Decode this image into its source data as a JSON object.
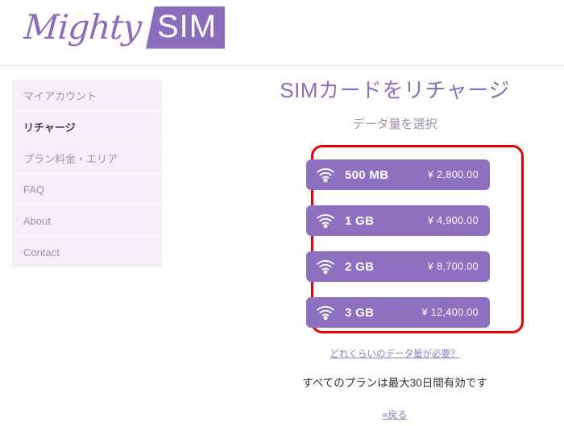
{
  "brand": {
    "name_script": "Mighty",
    "name_badge": "SIM",
    "accent_color": "#8a6ebd"
  },
  "sidebar": {
    "items": [
      {
        "label": "マイアカウント",
        "active": false
      },
      {
        "label": "リチャージ",
        "active": true
      },
      {
        "label": "プラン料金・エリア",
        "active": false
      },
      {
        "label": "FAQ",
        "active": false
      },
      {
        "label": "About",
        "active": false
      },
      {
        "label": "Contact",
        "active": false
      }
    ]
  },
  "main": {
    "title": "SIMカードをリチャージ",
    "subtitle": "データ量を選択",
    "highlight_color": "#ee0000",
    "plans": [
      {
        "size": "500 MB",
        "price": "¥ 2,800.00",
        "icon": "wifi-icon"
      },
      {
        "size": "1 GB",
        "price": "¥ 4,900.00",
        "icon": "wifi-icon"
      },
      {
        "size": "2 GB",
        "price": "¥ 8,700.00",
        "icon": "wifi-icon"
      },
      {
        "size": "3 GB",
        "price": "¥ 12,400.00",
        "icon": "wifi-icon"
      }
    ],
    "help_link": "どれくらいのデータ量が必要？",
    "note": "すべてのプランは最大30日間有効です",
    "back_link": "«戻る"
  }
}
